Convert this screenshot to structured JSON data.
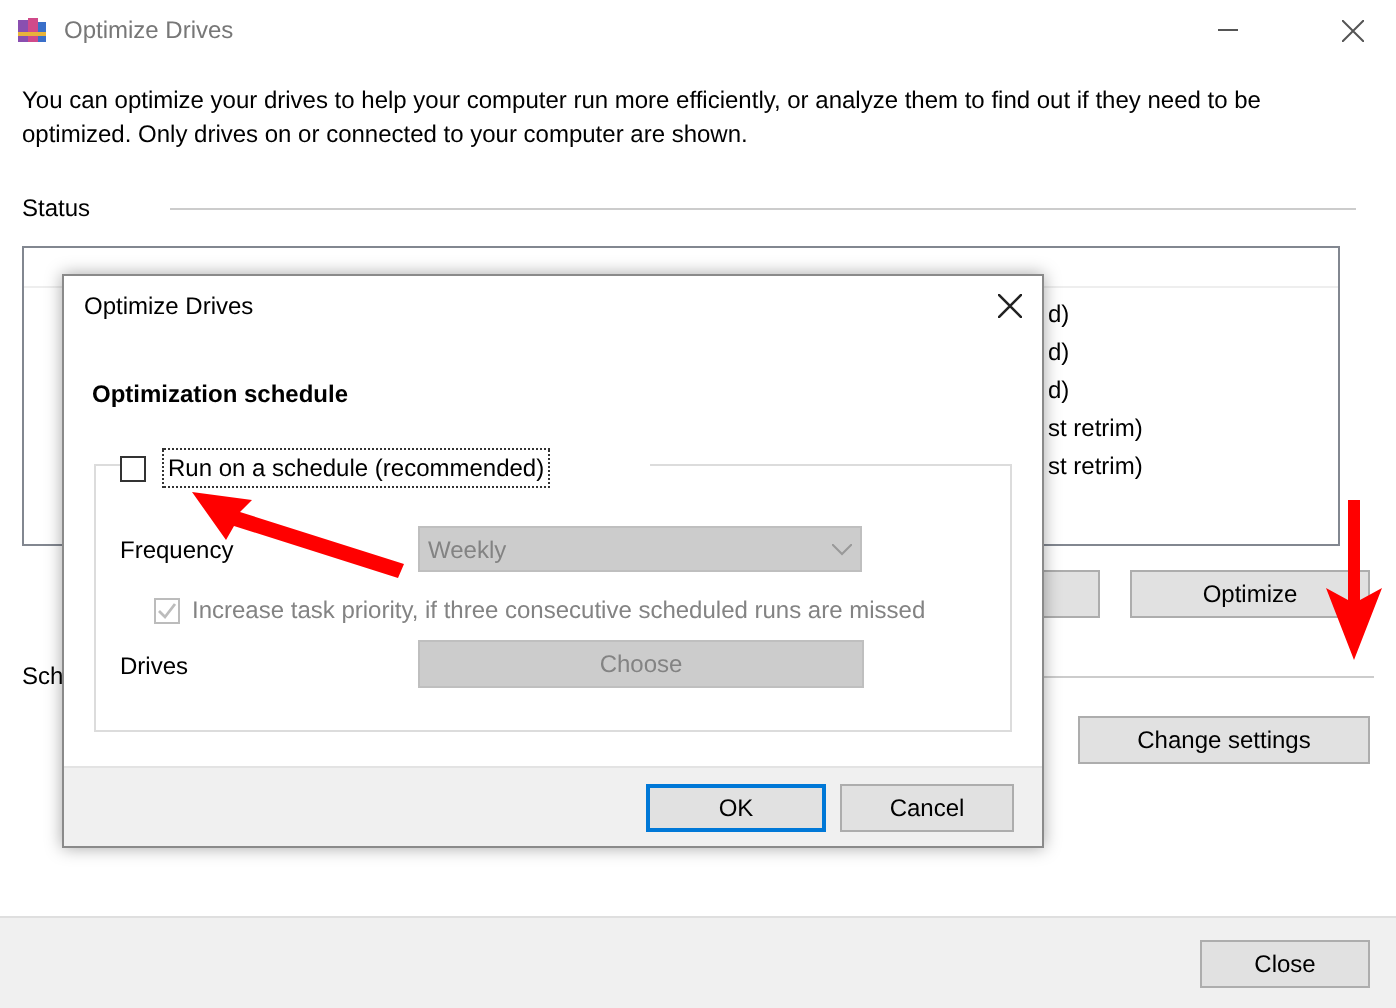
{
  "window": {
    "title": "Optimize Drives",
    "description": "You can optimize your drives to help your computer run more efficiently, or analyze them to find out if they need to be optimized. Only drives on or connected to your computer are shown."
  },
  "status": {
    "label": "Status",
    "visible_status_fragments": [
      "d)",
      "d)",
      "d)",
      "st retrim)",
      "st retrim)"
    ],
    "buttons": [
      {
        "kind": "blank"
      },
      {
        "kind": "labeled",
        "label": "Optimize"
      }
    ]
  },
  "schedule": {
    "label_fragment": "Sch",
    "button": "Change settings"
  },
  "footer": {
    "button": "Close"
  },
  "dialog": {
    "title": "Optimize Drives",
    "heading": "Optimization schedule",
    "run_on_schedule": {
      "label": "Run on a schedule (recommended)",
      "checked": false
    },
    "frequency": {
      "label": "Frequency",
      "value": "Weekly",
      "disabled": true
    },
    "increase_priority": {
      "label": "Increase task priority, if three consecutive scheduled runs are missed",
      "checked": true,
      "disabled": true
    },
    "drives": {
      "label": "Drives",
      "button": "Choose",
      "disabled": true
    },
    "buttons": [
      {
        "label": "OK",
        "default": true
      },
      {
        "label": "Cancel",
        "default": false
      }
    ]
  }
}
